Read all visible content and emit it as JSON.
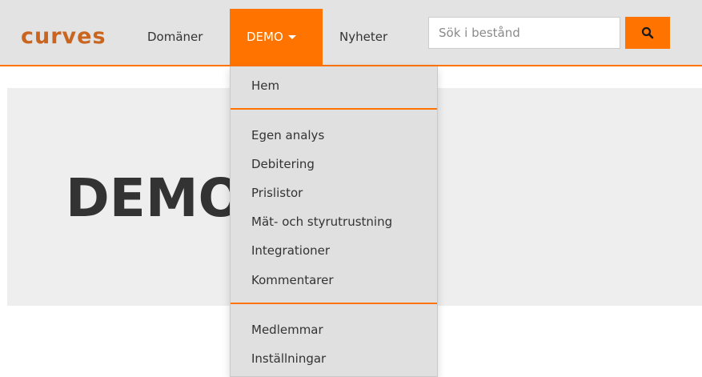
{
  "brand": {
    "logo_text": "curves"
  },
  "nav": {
    "items": [
      {
        "label": "Domäner"
      },
      {
        "label": "DEMO"
      },
      {
        "label": "Nyheter"
      }
    ]
  },
  "search": {
    "placeholder": "Sök i bestånd",
    "value": ""
  },
  "dropdown": {
    "groups": [
      [
        "Hem"
      ],
      [
        "Egen analys",
        "Debitering",
        "Prislistor",
        "Mät- och styrutrustning",
        "Integrationer",
        "Kommentarer"
      ],
      [
        "Medlemmar",
        "Inställningar"
      ]
    ]
  },
  "jumbotron": {
    "title": "DEMO"
  },
  "colors": {
    "accent": "#ff7400",
    "navbar_bg": "#e3e3e3",
    "dropdown_bg": "#e0e0e0",
    "jumbotron_bg": "#eeeeee",
    "logo": "#c9651f"
  }
}
